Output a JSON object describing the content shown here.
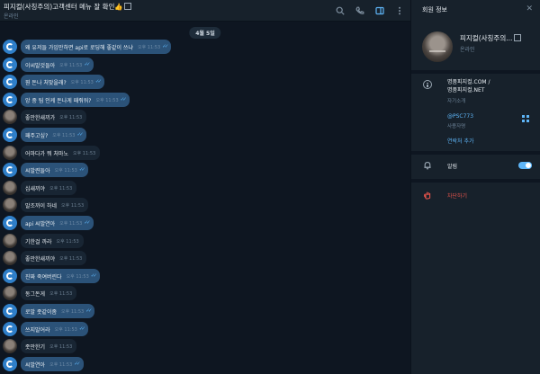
{
  "chat": {
    "title": "피지컬(사칭주의)고객센터 메뉴 잘 확인👍",
    "status": "온라인",
    "date": "4월 5일",
    "messages": [
      {
        "dir": "out",
        "text": "왜 유저들 가입만하면 api로 로딩해 좋같이 쓰냐",
        "time": "오후 11:53"
      },
      {
        "dir": "out",
        "text": "이씨발것들아",
        "time": "오후 11:53"
      },
      {
        "dir": "out",
        "text": "뭔 돈나 처맞을래?",
        "time": "오후 11:53"
      },
      {
        "dir": "out",
        "text": "앙 중 팀 인케 돈나게 패줘워?",
        "time": "오후 11:53"
      },
      {
        "dir": "in",
        "text": "좋만한새끼가",
        "time": "오후 11:53"
      },
      {
        "dir": "out",
        "text": "패주고싶?",
        "time": "오후 11:53"
      },
      {
        "dir": "in",
        "text": "어마다가 뭐 처마노",
        "time": "오후 11:53"
      },
      {
        "dir": "out",
        "text": "씨발련들아",
        "time": "오후 11:53"
      },
      {
        "dir": "in",
        "text": "십새끼야",
        "time": "오후 11:53"
      },
      {
        "dir": "in",
        "text": "말조까이 하네",
        "time": "오후 11:53"
      },
      {
        "dir": "out",
        "text": "api 씨발연아",
        "time": "오후 11:53"
      },
      {
        "dir": "in",
        "text": "기한걸 까라",
        "time": "오후 11:53"
      },
      {
        "dir": "in",
        "text": "좋만한새끼야",
        "time": "오후 11:53"
      },
      {
        "dir": "out",
        "text": "진짜 죽여버린다",
        "time": "오후 11:53"
      },
      {
        "dir": "in",
        "text": "동그돈게",
        "time": "오후 11:53"
      },
      {
        "dir": "out",
        "text": "로말 좃같이좀",
        "time": "오후 11:53"
      },
      {
        "dir": "out",
        "text": "쓰지말어라",
        "time": "오후 11:53"
      },
      {
        "dir": "in",
        "text": "좃만한기",
        "time": "오후 11:53"
      },
      {
        "dir": "out",
        "text": "씨발연아",
        "time": "오후 11:53"
      }
    ]
  },
  "header_icons": [
    "search-icon",
    "phone-icon",
    "sidebar-toggle-icon",
    "more-icon"
  ],
  "profile": {
    "panel_title": "회원 정보",
    "name": "피지컬(사칭주의...",
    "status": "온라인",
    "bio_line1": "명품피지컬.COM /",
    "bio_line2": "명품피지컬.NET",
    "bio_label": "자기소개",
    "username": "@PSC773",
    "username_label": "사용자명",
    "add_contact": "연락처 추가",
    "notifications_label": "알림",
    "notifications_on": true,
    "block_label": "차단하기"
  },
  "colors": {
    "accent": "#5eb5f7",
    "outgoing_bubble": "#2b5278",
    "incoming_bubble": "#182533",
    "danger": "#e5534b"
  }
}
